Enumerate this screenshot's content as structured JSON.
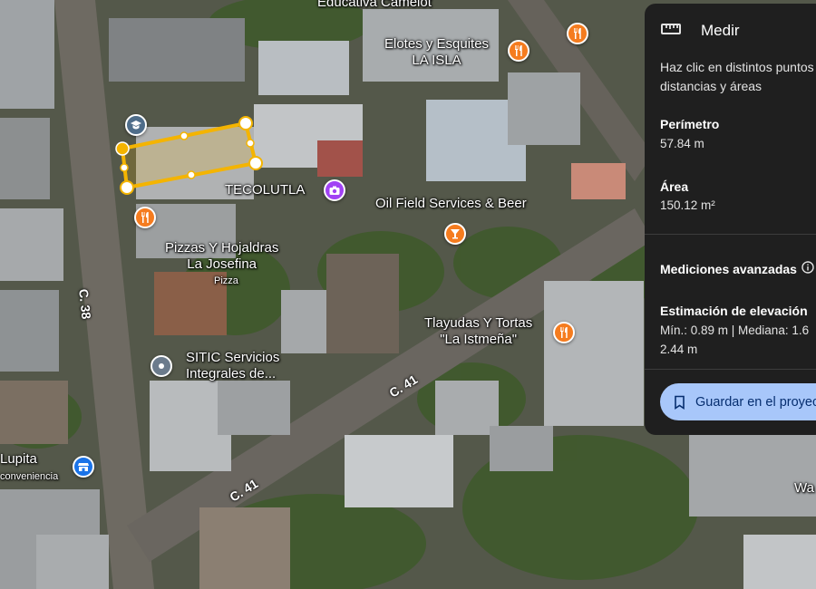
{
  "map": {
    "places": [
      {
        "name": "Educativa Camelot"
      },
      {
        "name": "Elotes y Esquites\nLA ISLA"
      },
      {
        "name": "TECOLUTLA"
      },
      {
        "name": "Oil Field Services & Beer"
      },
      {
        "name": "Pizzas Y Hojaldras\nLa Josefina",
        "category": "Pizza"
      },
      {
        "name": "Tlayudas Y Tortas\n\"La Istmeña\""
      },
      {
        "name": "SITIC Servicios\nIntegrales de..."
      },
      {
        "name": "Lupita",
        "category": "conveniencia"
      },
      {
        "name": "Wa"
      }
    ],
    "streets": [
      "C. 38",
      "C. 41",
      "C. 41"
    ]
  },
  "panel": {
    "title": "Medir",
    "description_line1": "Haz clic en distintos puntos",
    "description_line2": "distancias y áreas",
    "perimeter_label": "Perímetro",
    "perimeter_value": "57.84 m",
    "area_label": "Área",
    "area_value": "150.12 m²",
    "advanced_label": "Mediciones avanzadas",
    "elevation_label": "Estimación de elevación",
    "elevation_line1": "Mín.: 0.89 m | Mediana: 1.6",
    "elevation_line2": "2.44 m",
    "save_label": "Guardar en el proyecto"
  },
  "colors": {
    "measure_line": "#f4b400",
    "food_pin": "#f57c1f",
    "photo_pin": "#a142f4",
    "school_pin": "#4f6d8a",
    "store_pin": "#1a73e8",
    "generic_pin": "#6b7b8c",
    "save_button": "#a8c7fa"
  }
}
